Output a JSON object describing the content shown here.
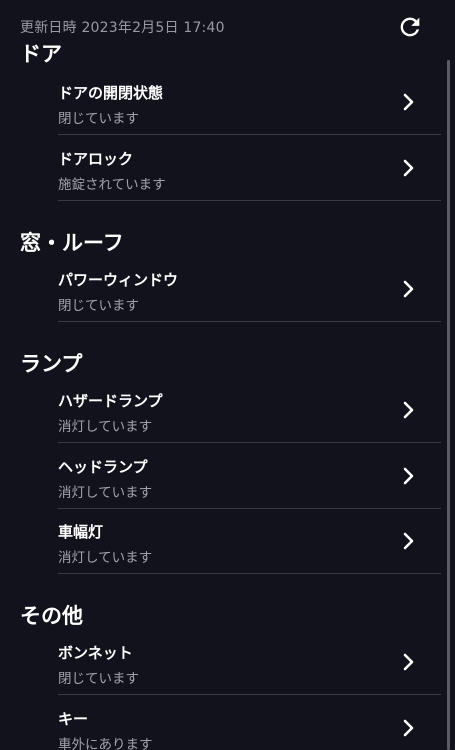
{
  "header": {
    "updated_text": "更新日時 2023年2月5日 17:40",
    "refresh_icon": "refresh-icon"
  },
  "sections": [
    {
      "title": "ドア",
      "items": [
        {
          "label": "ドアの開閉状態",
          "status": "閉じています"
        },
        {
          "label": "ドアロック",
          "status": "施錠されています"
        }
      ]
    },
    {
      "title": "窓・ルーフ",
      "items": [
        {
          "label": "パワーウィンドウ",
          "status": "閉じています"
        }
      ]
    },
    {
      "title": "ランプ",
      "items": [
        {
          "label": "ハザードランプ",
          "status": "消灯しています"
        },
        {
          "label": "ヘッドランプ",
          "status": "消灯しています"
        },
        {
          "label": "車幅灯",
          "status": "消灯しています"
        }
      ]
    },
    {
      "title": "その他",
      "items": [
        {
          "label": "ボンネット",
          "status": "閉じています"
        },
        {
          "label": "キー",
          "status": "車外にあります"
        }
      ]
    }
  ],
  "colors": {
    "background": "#12121c",
    "text_primary": "#ffffff",
    "text_secondary": "#a2a2aa",
    "divider": "#3a3a44"
  }
}
